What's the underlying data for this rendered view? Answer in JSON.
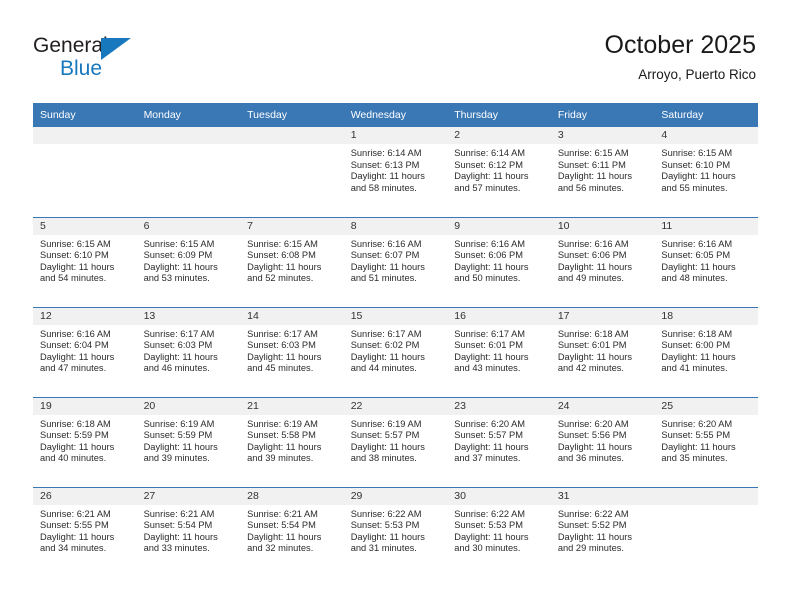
{
  "brand": {
    "name_top": "General",
    "name_bottom": "Blue",
    "accent_color": "#1878be",
    "triangle_icon": "general-blue-triangle"
  },
  "header": {
    "title": "October 2025",
    "subtitle": "Arroyo, Puerto Rico",
    "header_bg": "#3a77b5",
    "daynum_bg": "#f1f1f1"
  },
  "calendar": {
    "weekday_headers": [
      "Sunday",
      "Monday",
      "Tuesday",
      "Wednesday",
      "Thursday",
      "Friday",
      "Saturday"
    ],
    "weeks": [
      [
        {
          "day": "",
          "lines": []
        },
        {
          "day": "",
          "lines": []
        },
        {
          "day": "",
          "lines": []
        },
        {
          "day": "1",
          "lines": [
            "Sunrise: 6:14 AM",
            "Sunset: 6:13 PM",
            "Daylight: 11 hours",
            "and 58 minutes."
          ]
        },
        {
          "day": "2",
          "lines": [
            "Sunrise: 6:14 AM",
            "Sunset: 6:12 PM",
            "Daylight: 11 hours",
            "and 57 minutes."
          ]
        },
        {
          "day": "3",
          "lines": [
            "Sunrise: 6:15 AM",
            "Sunset: 6:11 PM",
            "Daylight: 11 hours",
            "and 56 minutes."
          ]
        },
        {
          "day": "4",
          "lines": [
            "Sunrise: 6:15 AM",
            "Sunset: 6:10 PM",
            "Daylight: 11 hours",
            "and 55 minutes."
          ]
        }
      ],
      [
        {
          "day": "5",
          "lines": [
            "Sunrise: 6:15 AM",
            "Sunset: 6:10 PM",
            "Daylight: 11 hours",
            "and 54 minutes."
          ]
        },
        {
          "day": "6",
          "lines": [
            "Sunrise: 6:15 AM",
            "Sunset: 6:09 PM",
            "Daylight: 11 hours",
            "and 53 minutes."
          ]
        },
        {
          "day": "7",
          "lines": [
            "Sunrise: 6:15 AM",
            "Sunset: 6:08 PM",
            "Daylight: 11 hours",
            "and 52 minutes."
          ]
        },
        {
          "day": "8",
          "lines": [
            "Sunrise: 6:16 AM",
            "Sunset: 6:07 PM",
            "Daylight: 11 hours",
            "and 51 minutes."
          ]
        },
        {
          "day": "9",
          "lines": [
            "Sunrise: 6:16 AM",
            "Sunset: 6:06 PM",
            "Daylight: 11 hours",
            "and 50 minutes."
          ]
        },
        {
          "day": "10",
          "lines": [
            "Sunrise: 6:16 AM",
            "Sunset: 6:06 PM",
            "Daylight: 11 hours",
            "and 49 minutes."
          ]
        },
        {
          "day": "11",
          "lines": [
            "Sunrise: 6:16 AM",
            "Sunset: 6:05 PM",
            "Daylight: 11 hours",
            "and 48 minutes."
          ]
        }
      ],
      [
        {
          "day": "12",
          "lines": [
            "Sunrise: 6:16 AM",
            "Sunset: 6:04 PM",
            "Daylight: 11 hours",
            "and 47 minutes."
          ]
        },
        {
          "day": "13",
          "lines": [
            "Sunrise: 6:17 AM",
            "Sunset: 6:03 PM",
            "Daylight: 11 hours",
            "and 46 minutes."
          ]
        },
        {
          "day": "14",
          "lines": [
            "Sunrise: 6:17 AM",
            "Sunset: 6:03 PM",
            "Daylight: 11 hours",
            "and 45 minutes."
          ]
        },
        {
          "day": "15",
          "lines": [
            "Sunrise: 6:17 AM",
            "Sunset: 6:02 PM",
            "Daylight: 11 hours",
            "and 44 minutes."
          ]
        },
        {
          "day": "16",
          "lines": [
            "Sunrise: 6:17 AM",
            "Sunset: 6:01 PM",
            "Daylight: 11 hours",
            "and 43 minutes."
          ]
        },
        {
          "day": "17",
          "lines": [
            "Sunrise: 6:18 AM",
            "Sunset: 6:01 PM",
            "Daylight: 11 hours",
            "and 42 minutes."
          ]
        },
        {
          "day": "18",
          "lines": [
            "Sunrise: 6:18 AM",
            "Sunset: 6:00 PM",
            "Daylight: 11 hours",
            "and 41 minutes."
          ]
        }
      ],
      [
        {
          "day": "19",
          "lines": [
            "Sunrise: 6:18 AM",
            "Sunset: 5:59 PM",
            "Daylight: 11 hours",
            "and 40 minutes."
          ]
        },
        {
          "day": "20",
          "lines": [
            "Sunrise: 6:19 AM",
            "Sunset: 5:59 PM",
            "Daylight: 11 hours",
            "and 39 minutes."
          ]
        },
        {
          "day": "21",
          "lines": [
            "Sunrise: 6:19 AM",
            "Sunset: 5:58 PM",
            "Daylight: 11 hours",
            "and 39 minutes."
          ]
        },
        {
          "day": "22",
          "lines": [
            "Sunrise: 6:19 AM",
            "Sunset: 5:57 PM",
            "Daylight: 11 hours",
            "and 38 minutes."
          ]
        },
        {
          "day": "23",
          "lines": [
            "Sunrise: 6:20 AM",
            "Sunset: 5:57 PM",
            "Daylight: 11 hours",
            "and 37 minutes."
          ]
        },
        {
          "day": "24",
          "lines": [
            "Sunrise: 6:20 AM",
            "Sunset: 5:56 PM",
            "Daylight: 11 hours",
            "and 36 minutes."
          ]
        },
        {
          "day": "25",
          "lines": [
            "Sunrise: 6:20 AM",
            "Sunset: 5:55 PM",
            "Daylight: 11 hours",
            "and 35 minutes."
          ]
        }
      ],
      [
        {
          "day": "26",
          "lines": [
            "Sunrise: 6:21 AM",
            "Sunset: 5:55 PM",
            "Daylight: 11 hours",
            "and 34 minutes."
          ]
        },
        {
          "day": "27",
          "lines": [
            "Sunrise: 6:21 AM",
            "Sunset: 5:54 PM",
            "Daylight: 11 hours",
            "and 33 minutes."
          ]
        },
        {
          "day": "28",
          "lines": [
            "Sunrise: 6:21 AM",
            "Sunset: 5:54 PM",
            "Daylight: 11 hours",
            "and 32 minutes."
          ]
        },
        {
          "day": "29",
          "lines": [
            "Sunrise: 6:22 AM",
            "Sunset: 5:53 PM",
            "Daylight: 11 hours",
            "and 31 minutes."
          ]
        },
        {
          "day": "30",
          "lines": [
            "Sunrise: 6:22 AM",
            "Sunset: 5:53 PM",
            "Daylight: 11 hours",
            "and 30 minutes."
          ]
        },
        {
          "day": "31",
          "lines": [
            "Sunrise: 6:22 AM",
            "Sunset: 5:52 PM",
            "Daylight: 11 hours",
            "and 29 minutes."
          ]
        },
        {
          "day": "",
          "lines": []
        }
      ]
    ]
  }
}
